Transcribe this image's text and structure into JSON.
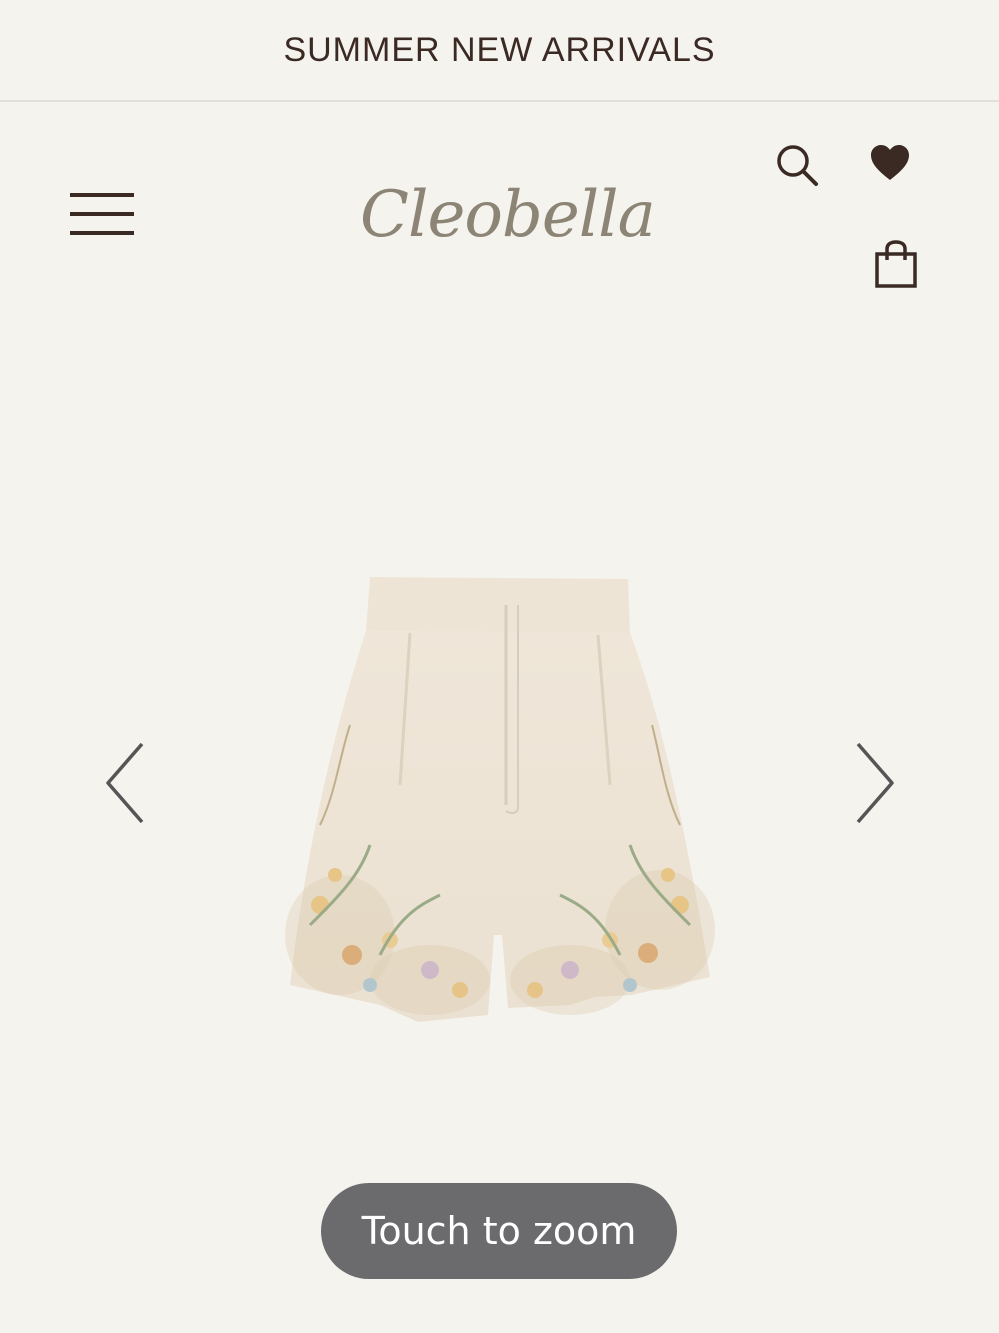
{
  "announcement": {
    "text": "SUMMER NEW ARRIVALS"
  },
  "header": {
    "logo_text": "Cleobella",
    "menu_icon": "hamburger-menu-icon",
    "search_icon": "search-icon",
    "wishlist_icon": "heart-icon",
    "cart_icon": "shopping-bag-icon"
  },
  "gallery": {
    "prev_icon": "chevron-left-icon",
    "next_icon": "chevron-right-icon",
    "zoom_label": "Touch to zoom"
  },
  "colors": {
    "background": "#f5f3ee",
    "text_dark": "#3b2a24",
    "logo": "#8c8475",
    "zoom_pill": "#6b6b6e"
  }
}
